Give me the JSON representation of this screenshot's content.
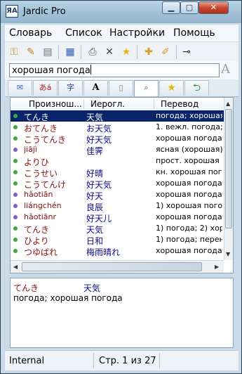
{
  "window": {
    "title": "Jardic Pro",
    "app_icon": "ЯA"
  },
  "window_controls": {
    "minimize": "▁",
    "maximize": "▢",
    "close": "✕"
  },
  "menu": [
    "Словарь",
    "Список",
    "Настройки",
    "Помощь"
  ],
  "toolbar_icons": [
    "key-icon",
    "brush-icon",
    "book-edit-icon",
    "books-icon",
    "printer-icon",
    "delete-icon",
    "star-icon",
    "note-add-icon",
    "note-edit-icon",
    "pin-icon"
  ],
  "search": {
    "value": "хорошая погода",
    "font_button": "A"
  },
  "tabs": [
    {
      "icon": "speech-icon",
      "label": ""
    },
    {
      "icon": "kana-icon",
      "label": "あá"
    },
    {
      "icon": "kanji-icon",
      "label": "字"
    },
    {
      "icon": "font-icon",
      "label": "A"
    },
    {
      "icon": "page-icon",
      "label": ""
    },
    {
      "icon": "search-book-icon",
      "label": ""
    },
    {
      "icon": "star-icon",
      "label": ""
    },
    {
      "icon": "back-icon",
      "label": ""
    }
  ],
  "columns": [
    "Произнош...",
    "Иерогл.",
    "Перевод"
  ],
  "rows": [
    {
      "reading": "てんき",
      "kanji": "天気",
      "translation": "погода; хорошая",
      "dot": "#3fa845",
      "selected": true,
      "type": "kana"
    },
    {
      "reading": "おてんき",
      "kanji": "お天気",
      "translation": "1. вежл. погода; х",
      "dot": "#3fa845",
      "type": "kana"
    },
    {
      "reading": "こうてんき",
      "kanji": "好天気",
      "translation": "хорошая погода",
      "dot": "#3fa845",
      "type": "kana"
    },
    {
      "reading": "jiājì",
      "kanji": "佳霁",
      "translation": "ясная (хорошая)",
      "dot": "#8a5cc7",
      "type": "pinyin"
    },
    {
      "reading": "よりひ",
      "kanji": "",
      "translation": "прост. хорошая",
      "dot": "#3fa845",
      "type": "kana"
    },
    {
      "reading": "こうせい",
      "kanji": "好晴",
      "translation": "кн. хорошая пого",
      "dot": "#3fa845",
      "type": "kana"
    },
    {
      "reading": "こうてんけ",
      "kanji": "好天気",
      "translation": "хорошая погода",
      "dot": "#3fa845",
      "type": "kana"
    },
    {
      "reading": "hǎotiān",
      "kanji": "好天",
      "translation": "хорошая погода",
      "dot": "#8a5cc7",
      "type": "pinyin"
    },
    {
      "reading": "liángchén",
      "kanji": "良辰",
      "translation": "1) хорошая погод",
      "dot": "#8a5cc7",
      "type": "pinyin"
    },
    {
      "reading": "hǎotiānr",
      "kanji": "好天儿",
      "translation": "хорошая погода",
      "dot": "#8a5cc7",
      "type": "pinyin"
    },
    {
      "reading": "てんき",
      "kanji": "天気",
      "translation": "1) погода; 2) хор",
      "dot": "#3fa845",
      "type": "kana"
    },
    {
      "reading": "ひより",
      "kanji": "日和",
      "translation": "1) погода; перен",
      "dot": "#3fa845",
      "type": "kana"
    },
    {
      "reading": "つゆばれ",
      "kanji": "梅雨晴れ",
      "translation": "хорошая погода",
      "dot": "#3fa845",
      "type": "kana"
    }
  ],
  "detail": {
    "reading": "てんき",
    "kanji": "天気",
    "translation": "погода; хорошая погода"
  },
  "status": {
    "source": "Internal",
    "page": "Стр. 1 из 27"
  }
}
